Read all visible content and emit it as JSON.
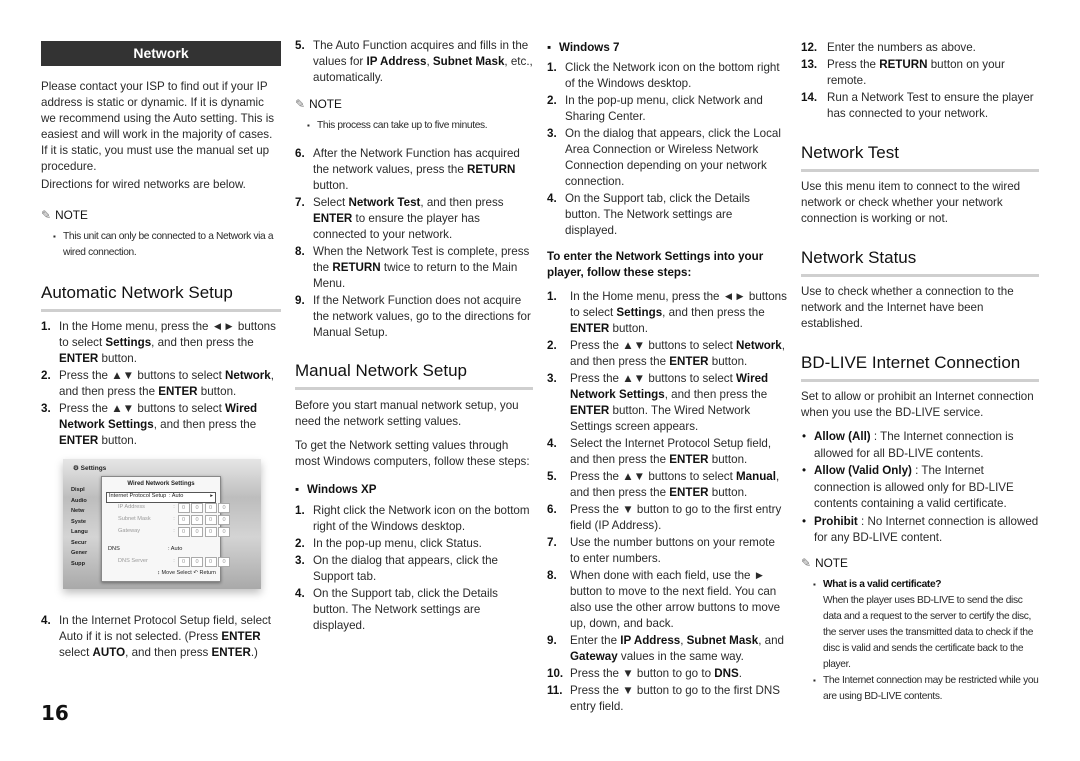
{
  "page_number": "16",
  "col1": {
    "banner": "Network",
    "intro": "Please contact your ISP to find out if your IP address is static or dynamic. If it is dynamic we recommend using the Auto setting. This is easiest and will work in the majority of cases. If it is static, you must use the manual set up procedure.",
    "directions": "Directions for  wired networks are below.",
    "note_label": "NOTE",
    "note_items": [
      "This unit can only be connected to a Network via a wired connection."
    ],
    "auto_heading": "Automatic Network Setup",
    "auto_steps": [
      {
        "n": "1.",
        "html": "In the Home menu, press the ◄► buttons to select <b>Settings</b>, and then press the <b>ENTER</b> button."
      },
      {
        "n": "2.",
        "html": "Press the ▲▼ buttons to select <b>Network</b>, and then press the <b>ENTER</b> button."
      },
      {
        "n": "3.",
        "html": "Press the ▲▼ buttons to select <b>Wired Network Settings</b>, and then press the <b>ENTER</b> button."
      }
    ],
    "screenshot": {
      "title": "Settings",
      "menu_items": [
        "Displ",
        "Audio",
        "Netw",
        "Syste",
        "Langu",
        "Secur",
        "Gener",
        "Supp"
      ],
      "dialog_title": "Wired Network Settings",
      "rows": [
        {
          "label": "Internet Protocol Setup",
          "value": ": Auto",
          "selected": true
        },
        {
          "label": "IP Address",
          "boxes": [
            "0",
            "0",
            "0",
            "0"
          ]
        },
        {
          "label": "Subnet Mask",
          "boxes": [
            "0",
            "0",
            "0",
            "0"
          ]
        },
        {
          "label": "Gateway",
          "boxes": [
            "0",
            "0",
            "0",
            "0"
          ]
        },
        {
          "label": "DNS",
          "value": ": Auto"
        },
        {
          "label": "DNS Server",
          "boxes": [
            "0",
            "0",
            "0",
            "0"
          ]
        }
      ],
      "footer": [
        "↕ Move",
        "Select",
        "↶ Return"
      ]
    },
    "step4": {
      "n": "4.",
      "html": "In the Internet Protocol Setup field, select Auto if it is not selected. (Press <b>ENTER</b> select <b>AUTO</b>, and then press <b>ENTER</b>.)"
    }
  },
  "col2": {
    "steps_a": [
      {
        "n": "5.",
        "html": "The Auto Function acquires and fills in the values for <b>IP Address</b>, <b>Subnet Mask</b>, etc., automatically."
      }
    ],
    "note_label": "NOTE",
    "note_items": [
      "This process can take up to five minutes."
    ],
    "steps_b": [
      {
        "n": "6.",
        "html": "After the Network Function has acquired the network values, press the <b>RETURN</b> button."
      },
      {
        "n": "7.",
        "html": "Select <b>Network Test</b>, and then press <b>ENTER</b> to ensure the player has connected to your network."
      },
      {
        "n": "8.",
        "html": "When the Network Test is complete, press the <b>RETURN</b> twice to return to the Main Menu."
      },
      {
        "n": "9.",
        "html": "If the Network Function does not acquire the network values, go to the directions for Manual Setup."
      }
    ],
    "manual_heading": "Manual Network Setup",
    "manual_p1": "Before you start manual network setup, you need the network setting values.",
    "manual_p2": "To get the Network setting values through most Windows computers, follow these steps:",
    "xp_label": "Windows XP",
    "xp_steps": [
      {
        "n": "1.",
        "html": "Right click the Network icon on the bottom right of the Windows desktop."
      },
      {
        "n": "2.",
        "html": "In the pop-up menu, click Status."
      },
      {
        "n": "3.",
        "html": "On the dialog that appears, click the Support tab."
      },
      {
        "n": "4.",
        "html": "On the Support tab, click the Details button. The Network settings are displayed."
      }
    ]
  },
  "col3": {
    "win7_label": "Windows 7",
    "win7_steps": [
      {
        "n": "1.",
        "html": "Click the Network icon on the bottom right of the Windows desktop."
      },
      {
        "n": "2.",
        "html": "In the pop-up menu, click Network and Sharing Center."
      },
      {
        "n": "3.",
        "html": "On the dialog that appears, click the Local Area Connection or Wireless Network Connection depending on your network connection."
      },
      {
        "n": "4.",
        "html": "On the Support tab, click the Details button. The Network settings are displayed."
      }
    ],
    "enter_heading": "To enter the Network Settings into your player, follow these steps:",
    "enter_steps": [
      {
        "n": "1.",
        "html": "In the Home menu, press the ◄► buttons to select <b>Settings</b>, and then press the <b>ENTER</b> button."
      },
      {
        "n": "2.",
        "html": "Press the ▲▼ buttons to select <b>Network</b>, and then press the <b>ENTER</b> button."
      },
      {
        "n": "3.",
        "html": "Press the ▲▼ buttons to select <b>Wired Network Settings</b>, and then press the <b>ENTER</b> button. The Wired Network Settings screen appears."
      },
      {
        "n": "4.",
        "html": "Select the Internet Protocol Setup field, and then press the <b>ENTER</b> button."
      },
      {
        "n": "5.",
        "html": "Press the ▲▼ buttons to select <b>Manual</b>, and then press the <b>ENTER</b> button."
      },
      {
        "n": "6.",
        "html": "Press the ▼ button to go to the first entry field (IP Address)."
      },
      {
        "n": "7.",
        "html": "Use the number buttons on your remote to enter numbers."
      },
      {
        "n": "8.",
        "html": "When done with each field, use the ► button to move to the next field. You can also use the other arrow buttons to move up, down, and back."
      },
      {
        "n": "9.",
        "html": "Enter the <b>IP Address</b>, <b>Subnet Mask</b>, and <b>Gateway</b> values in the same way."
      },
      {
        "n": "10.",
        "html": "Press the ▼ button to go to <b>DNS</b>."
      },
      {
        "n": "11.",
        "html": "Press the ▼ button to go to the first DNS entry field."
      }
    ]
  },
  "col4": {
    "steps": [
      {
        "n": "12.",
        "html": "Enter the numbers as above."
      },
      {
        "n": "13.",
        "html": "Press the <b>RETURN</b> button on your remote."
      },
      {
        "n": "14.",
        "html": "Run a Network Test to ensure the player has connected to your network."
      }
    ],
    "test_heading": "Network Test",
    "test_text": "Use this menu item to connect to the wired network or check whether your network connection is working or not.",
    "status_heading": "Network Status",
    "status_text": "Use to check whether a connection to the network and the Internet have been established.",
    "bdlive_heading": "BD-LIVE Internet Connection",
    "bdlive_text": "Set to allow or prohibit an Internet connection when you use the BD-LIVE service.",
    "bdlive_options": [
      {
        "html": "<b>Allow (All)</b> : The Internet connection is allowed for all BD-LIVE contents."
      },
      {
        "html": "<b>Allow (Valid Only)</b> : The Internet connection is allowed only for BD-LIVE contents containing a valid certificate."
      },
      {
        "html": "<b>Prohibit</b> : No Internet connection is allowed for any BD-LIVE content."
      }
    ],
    "note_label": "NOTE",
    "note_items": [
      {
        "html": "<b>What is a valid certificate?</b><br>When the player uses BD-LIVE to send the disc data and a request to the server to certify the disc, the server uses the transmitted data to check if the disc is valid and sends the certificate back to the player."
      },
      {
        "html": "The Internet connection may be restricted while you are using BD-LIVE contents."
      }
    ]
  }
}
